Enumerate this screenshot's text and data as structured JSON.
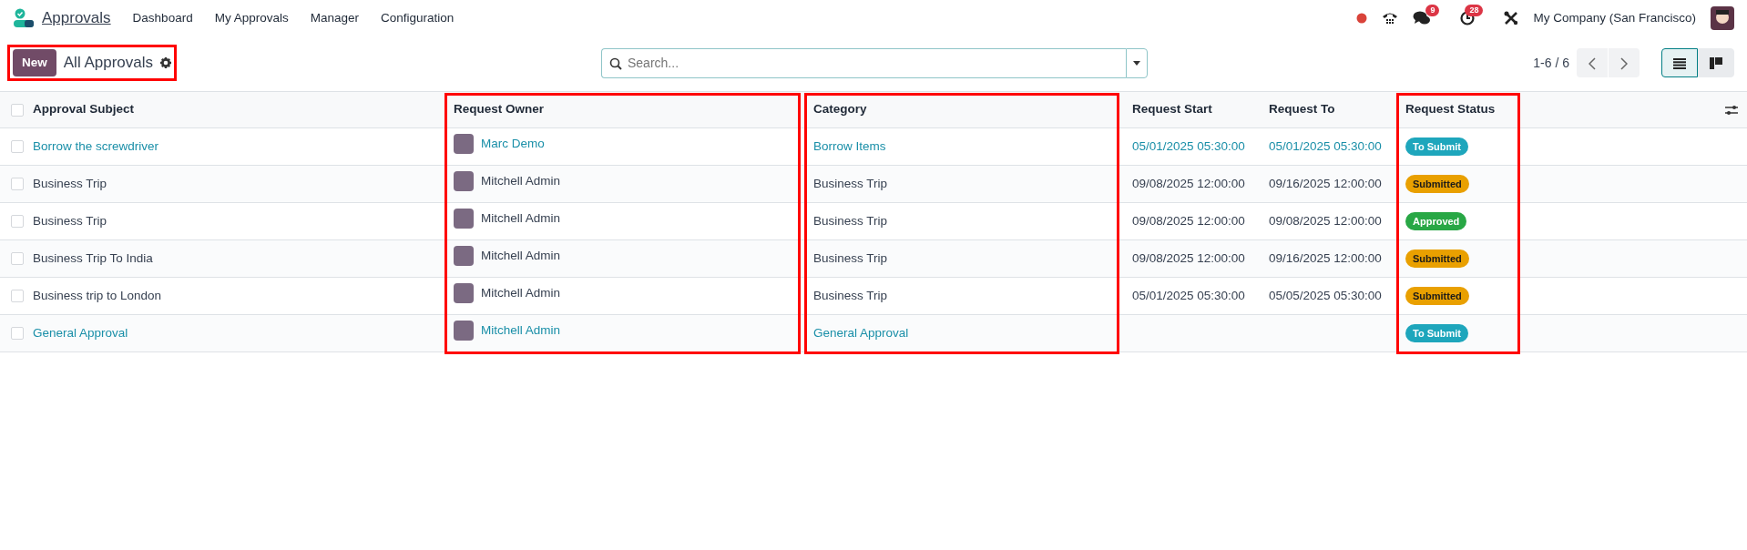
{
  "navbar": {
    "app_name": "Approvals",
    "menu": [
      "Dashboard",
      "My Approvals",
      "Manager",
      "Configuration"
    ],
    "systray": {
      "messages_count": "9",
      "activities_count": "28",
      "company": "My Company (San Francisco)"
    }
  },
  "control_panel": {
    "new_button": "New",
    "title": "All Approvals",
    "highlighted": true,
    "search": {
      "placeholder": "Search..."
    },
    "pager": "1-6 / 6",
    "views": [
      {
        "kind": "list",
        "selected": true
      },
      {
        "kind": "kanban",
        "selected": false
      }
    ]
  },
  "table": {
    "select_all": {
      "checked": false
    },
    "columns": [
      {
        "label": "Approval Subject",
        "highlighted": false
      },
      {
        "label": "Request Owner",
        "highlighted": true
      },
      {
        "label": "Category",
        "highlighted": true
      },
      {
        "label": "Request Start",
        "highlighted": false
      },
      {
        "label": "Request To",
        "highlighted": false
      },
      {
        "label": "Request Status",
        "highlighted": true
      }
    ],
    "rows": [
      {
        "checked": false,
        "accent": true,
        "subject": "Borrow the screwdriver",
        "owner": "Marc Demo",
        "category": "Borrow Items",
        "start": "05/01/2025 05:30:00",
        "end": "05/01/2025 05:30:00",
        "status": {
          "label": "To Submit",
          "color": "#1ea6bc"
        }
      },
      {
        "checked": false,
        "accent": false,
        "subject": "Business Trip",
        "owner": "Mitchell Admin",
        "category": "Business Trip",
        "start": "09/08/2025 12:00:00",
        "end": "09/16/2025 12:00:00",
        "status": {
          "label": "Submitted",
          "color": "#e9a000"
        }
      },
      {
        "checked": false,
        "accent": false,
        "subject": "Business Trip",
        "owner": "Mitchell Admin",
        "category": "Business Trip",
        "start": "09/08/2025 12:00:00",
        "end": "09/08/2025 12:00:00",
        "status": {
          "label": "Approved",
          "color": "#28a745"
        }
      },
      {
        "checked": false,
        "accent": false,
        "subject": "Business Trip To India",
        "owner": "Mitchell Admin",
        "category": "Business Trip",
        "start": "09/08/2025 12:00:00",
        "end": "09/16/2025 12:00:00",
        "status": {
          "label": "Submitted",
          "color": "#e9a000"
        }
      },
      {
        "checked": false,
        "accent": false,
        "subject": "Business trip to London",
        "owner": "Mitchell Admin",
        "category": "Business Trip",
        "start": "05/01/2025 05:30:00",
        "end": "05/05/2025 05:30:00",
        "status": {
          "label": "Submitted",
          "color": "#e9a000"
        }
      },
      {
        "checked": false,
        "accent": true,
        "subject": "General Approval",
        "owner": "Mitchell Admin",
        "category": "General Approval",
        "status": {
          "label": "To Submit",
          "color": "#1ea6bc"
        }
      }
    ]
  }
}
